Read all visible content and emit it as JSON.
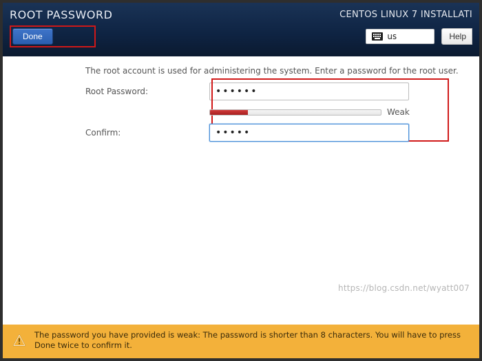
{
  "header": {
    "page_title": "ROOT PASSWORD",
    "install_title": "CENTOS LINUX 7 INSTALLATI",
    "done_label": "Done",
    "keyboard_layout": "us",
    "help_label": "Help"
  },
  "body": {
    "intro": "The root account is used for administering the system.  Enter a password for the root user.",
    "root_pw_label": "Root Password:",
    "confirm_label": "Confirm:",
    "root_pw_value": "••••••",
    "confirm_value": "•••••",
    "strength_label": "Weak"
  },
  "warning": {
    "text": "The password you have provided is weak: The password is shorter than 8 characters. You will have to press Done twice to confirm it."
  },
  "watermark": "https://blog.csdn.net/wyatt007"
}
